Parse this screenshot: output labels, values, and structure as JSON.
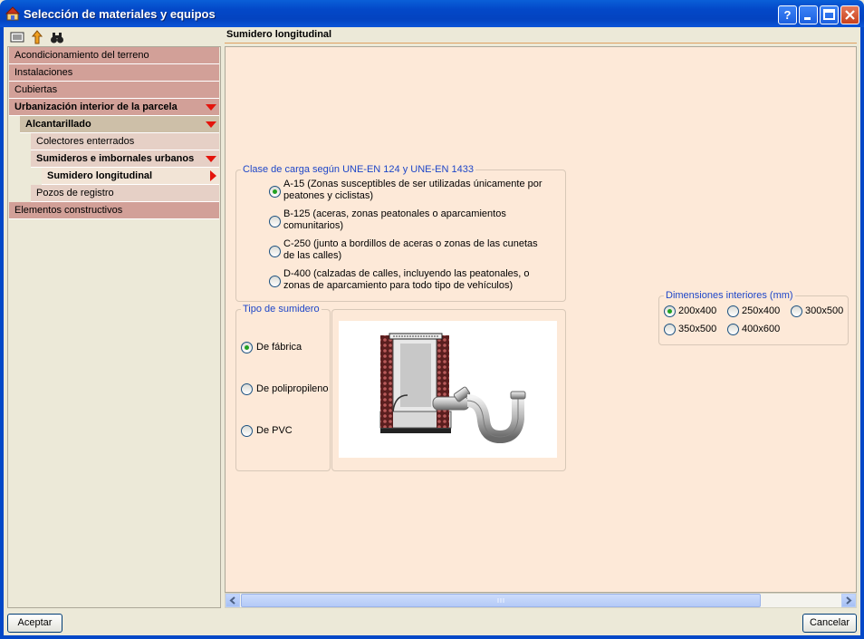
{
  "window": {
    "title": "Selección de materiales y equipos",
    "help_label": "?",
    "colors": {
      "titlebar": "#0348c8",
      "panel_bg": "#fde9d8",
      "legend_text": "#1e46c8"
    }
  },
  "toolbar": {
    "icons": [
      "list-view-icon",
      "navigate-up-icon",
      "find-binoculars-icon"
    ]
  },
  "tree": {
    "items": [
      {
        "label": "Acondicionamiento del terreno",
        "level": 0,
        "expanded": false
      },
      {
        "label": "Instalaciones",
        "level": 0,
        "expanded": false
      },
      {
        "label": "Cubiertas",
        "level": 0,
        "expanded": false
      },
      {
        "label": "Urbanización interior de la parcela",
        "level": 0,
        "expanded": true
      },
      {
        "label": "Alcantarillado",
        "level": 1,
        "expanded": true
      },
      {
        "label": "Colectores enterrados",
        "level": 2,
        "expanded": false
      },
      {
        "label": "Sumideros e imbornales urbanos",
        "level": 2,
        "expanded": true
      },
      {
        "label": "Sumidero longitudinal",
        "level": 3,
        "selected": true
      },
      {
        "label": "Pozos de registro",
        "level": 2,
        "expanded": false
      },
      {
        "label": "Elementos constructivos",
        "level": 0,
        "expanded": false
      }
    ]
  },
  "panel": {
    "title": "Sumidero longitudinal",
    "load_class": {
      "legend": "Clase de carga según UNE-EN 124 y UNE-EN 1433",
      "selected": "A-15",
      "options": [
        {
          "code": "A-15",
          "line1": "A-15 (Zonas susceptibles de ser utilizadas únicamente por",
          "line2": "peatones y ciclistas)"
        },
        {
          "code": "B-125",
          "line1": "B-125 (aceras, zonas peatonales o aparcamientos",
          "line2": "comunitarios)"
        },
        {
          "code": "C-250",
          "line1": "C-250 (junto a bordillos de aceras o zonas de las cunetas",
          "line2": "de las calles)"
        },
        {
          "code": "D-400",
          "line1": "D-400 (calzadas de calles, incluyendo las peatonales, o",
          "line2": "zonas de aparcamiento para todo tipo de vehículos)"
        }
      ]
    },
    "drain_type": {
      "legend": "Tipo de sumidero",
      "selected": "De fábrica",
      "options": [
        "De fábrica",
        "De polipropileno",
        "De PVC"
      ]
    },
    "dimensions": {
      "legend": "Dimensiones interiores (mm)",
      "selected": "200x400",
      "options": [
        "200x400",
        "250x400",
        "300x500",
        "350x500",
        "400x600"
      ]
    }
  },
  "footer": {
    "accept_label": "Aceptar",
    "cancel_label": "Cancelar"
  }
}
